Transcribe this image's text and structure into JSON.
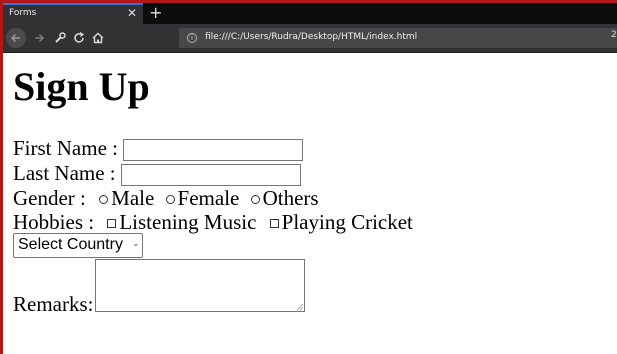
{
  "browser": {
    "tab_title": "Forms",
    "tab_close": "✕",
    "new_tab": "+",
    "url": "file:///C:/Users/Rudra/Desktop/HTML/index.html",
    "info_icon": "i",
    "toolbar_right": "2"
  },
  "form": {
    "heading": "Sign Up",
    "first_name_label": "First Name :",
    "last_name_label": "Last Name :",
    "gender_label": "Gender :",
    "gender_options": [
      "Male",
      "Female",
      "Others"
    ],
    "hobbies_label": "Hobbies :",
    "hobby_options": [
      "Listening Music",
      "Playing Cricket"
    ],
    "country_select": "Select Country",
    "remarks_label": "Remarks:"
  },
  "colors": {
    "window_frame": "#b01818",
    "tab_accent": "#3d6cd6",
    "toolbar": "#323234"
  }
}
